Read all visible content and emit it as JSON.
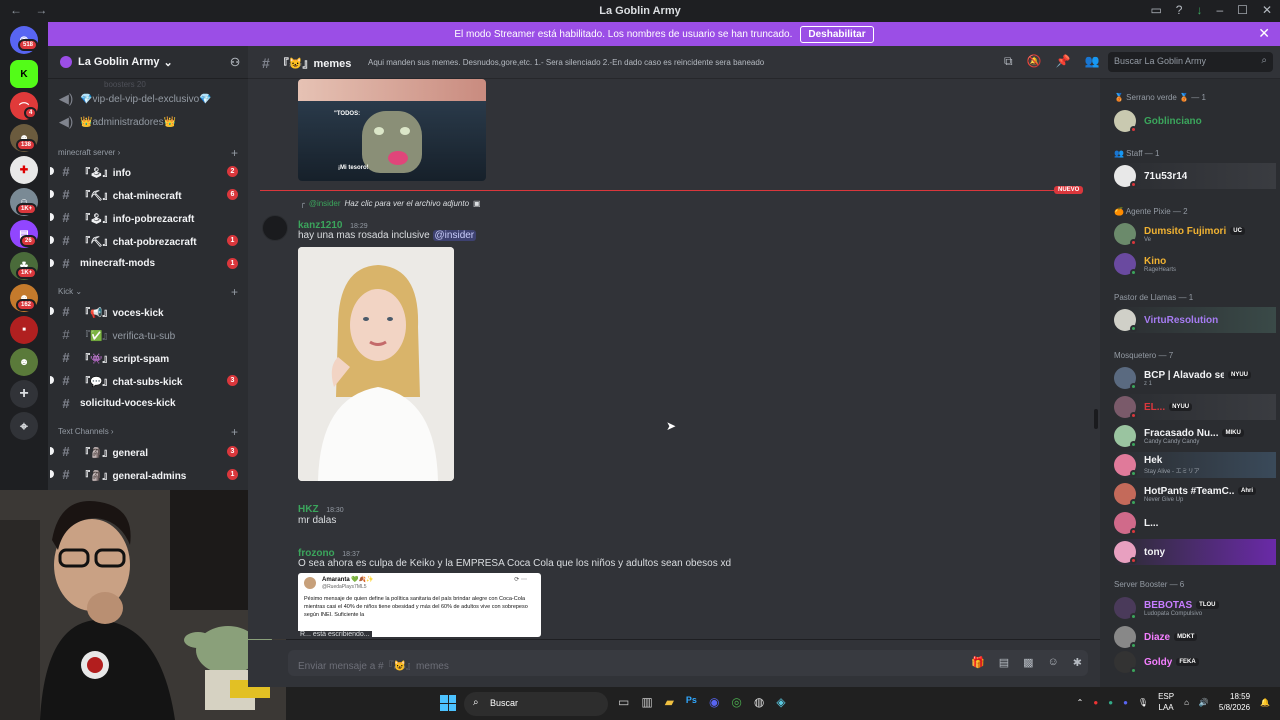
{
  "window": {
    "title": "La Goblin Army",
    "nav_back": "←",
    "nav_forward": "→"
  },
  "streamer_bar": {
    "message": "El modo Streamer está habilitado. Los nombres de usuario se han truncado.",
    "button": "Deshabilitar",
    "close": "✕"
  },
  "rail": {
    "badges": [
      "518",
      "4",
      "138",
      "1K+",
      "26",
      "1K+",
      "162"
    ],
    "add": "+",
    "explore": "⌖"
  },
  "server": {
    "name": "La Goblin Army",
    "chevron": "⌄"
  },
  "sidebar": {
    "cut_text": "boosters 20",
    "channels_top": [
      {
        "label": "💎vip-del-vip-del-exclusivo💎"
      },
      {
        "label": "👑administradores👑"
      }
    ],
    "categories": {
      "minecraft": "minecraft server",
      "kick": "Kick",
      "text": "Text Channels"
    },
    "minecraft": [
      {
        "label": "『🕹』info",
        "count": "2"
      },
      {
        "label": "『⛏』chat-minecraft",
        "count": "6"
      },
      {
        "label": "『🕹』info-pobrezacraft",
        "count": ""
      },
      {
        "label": "『⛏』chat-pobrezacraft",
        "count": "1"
      },
      {
        "label": "minecraft-mods",
        "count": "1"
      }
    ],
    "kick": [
      {
        "label": "『📢』voces-kick",
        "count": ""
      },
      {
        "label": "『✅』verifica-tu-sub",
        "count": ""
      },
      {
        "label": "『👾』script-spam",
        "count": ""
      },
      {
        "label": "『💬』chat-subs-kick",
        "count": "3"
      },
      {
        "label": "solicitud-voces-kick",
        "count": ""
      }
    ],
    "text": [
      {
        "label": "『🗿』general",
        "count": "3"
      },
      {
        "label": "『🗿』general-admins",
        "count": "1"
      }
    ]
  },
  "header": {
    "channel": "『😺』memes",
    "topic": "Aqui manden sus memes. Desnudos,gore,etc. 1.- Sera silenciado 2.-En dado caso es reincidente sera baneado",
    "search_placeholder": "Buscar La Goblin Army"
  },
  "messages": {
    "meme_caption_top": "\"TODOS:",
    "meme_caption_bottom": "¡Mi tesoro!",
    "new_label": "NUEVO",
    "reply_user": "@insider",
    "reply_text": "Haz clic para ver el archivo adjunto",
    "m1": {
      "user": "kanz1210",
      "time": "18:29",
      "text": "hay una mas rosada inclusive",
      "mention": "@insider"
    },
    "m2": {
      "user": "HKZ",
      "time": "18:30",
      "text": "mr dalas"
    },
    "m3": {
      "user": "frozono",
      "time": "18:37",
      "text": "O sea ahora es culpa de Keiko y la EMPRESA Coca Cola que los niños y adultos sean obesos xd"
    },
    "embed": {
      "author": "Amaranta 💚🍂✨",
      "handle": "@RuedaPlays7ML5",
      "body": "Pésimo mensaje de quien define la política sanitaria del país brindar alegre con Coca-Cola mientras casi el 40% de niños tiene obesidad y más del 60% de adultos vive con sobrepeso según INEI. Suficiente la",
      "typing": "R... está escribiendo..."
    }
  },
  "composer": {
    "placeholder": "Enviar mensaje a #『😺』memes"
  },
  "members": {
    "groups": [
      {
        "label": "🥉 Serrano verde 🥉 — 1"
      },
      {
        "label": "👥 Staff — 1"
      },
      {
        "label": "🍊 Agente Pixie — 2"
      },
      {
        "label": "Pastor de Llamas — 1"
      },
      {
        "label": "Mosquetero — 7"
      },
      {
        "label": "Server Booster — 6"
      }
    ],
    "list": [
      {
        "name": "Goblinciano",
        "sub": "",
        "tag": "",
        "color": "#3ba55c"
      },
      {
        "name": "71u53r14",
        "sub": "",
        "tag": "",
        "color": "#f2f3f5"
      },
      {
        "name": "Dumsito Fujimori",
        "sub": "Ve",
        "tag": "UC",
        "color": "#f0b232"
      },
      {
        "name": "Kino",
        "sub": "RageHearts",
        "tag": "",
        "color": "#f0b232"
      },
      {
        "name": "VirtuResolution",
        "sub": "",
        "tag": "",
        "color": "#a67cf2"
      },
      {
        "name": "BCP | Alavado se...",
        "sub": "z 1",
        "tag": "NYUU",
        "color": "#f2f3f5"
      },
      {
        "name": "EL...",
        "sub": "",
        "tag": "NYUU",
        "color": "#da373c"
      },
      {
        "name": "Fracasado Nu...",
        "sub": "Candy Candy Candy",
        "tag": "MIKU",
        "color": "#f2f3f5"
      },
      {
        "name": "Hek",
        "sub": "Stay Alive - エミリア",
        "tag": "",
        "color": "#f2f3f5"
      },
      {
        "name": "HotPants #TeamC...",
        "sub": "Never Give Up",
        "tag": "Ahri",
        "color": "#f2f3f5"
      },
      {
        "name": "L...",
        "sub": "",
        "tag": "",
        "color": "#f2f3f5"
      },
      {
        "name": "tony",
        "sub": "",
        "tag": "",
        "color": "#f2f3f5"
      },
      {
        "name": "BEBOTAS",
        "sub": "Ludopata Compulsivo",
        "tag": "TLOU",
        "color": "#c77dff"
      },
      {
        "name": "Diaze",
        "sub": "",
        "tag": "MDKT",
        "color": "#f47fff"
      },
      {
        "name": "Goldy",
        "sub": "",
        "tag": "FEKA",
        "color": "#f47fff"
      }
    ]
  },
  "taskbar": {
    "search": "Buscar",
    "lang": "ESP",
    "lang2": "LAA",
    "time": "18:59",
    "date": "5/8/2026"
  },
  "colors": {
    "accent": "#9b4ee6",
    "unread_badge": "#da373c",
    "new_line": "#da373c",
    "mention": "#5865f2"
  }
}
